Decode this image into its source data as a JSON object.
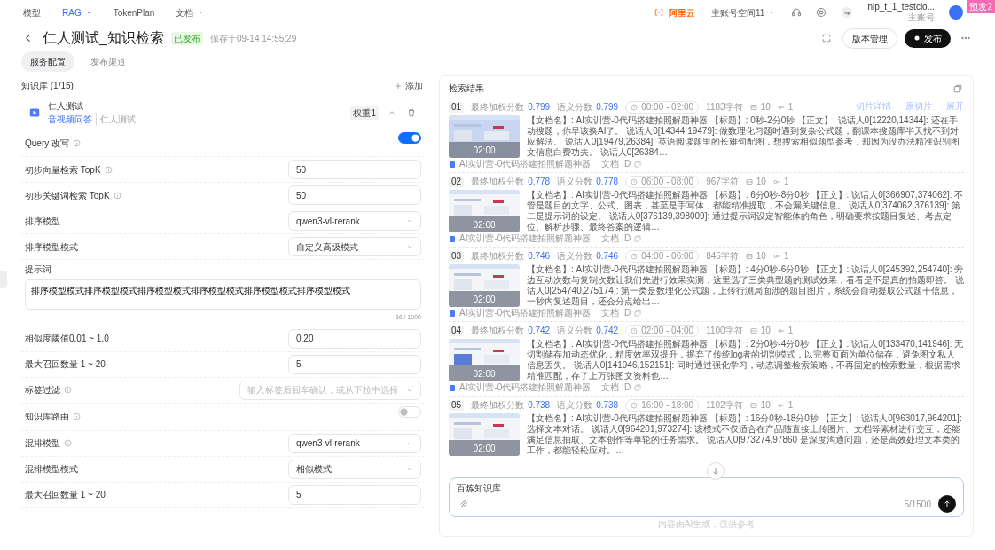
{
  "top_nav": {
    "items": [
      {
        "label": "模型",
        "selected": false,
        "dropdown": false
      },
      {
        "label": "RAG",
        "selected": true,
        "dropdown": true
      },
      {
        "label": "TokenPlan",
        "selected": false,
        "dropdown": false
      },
      {
        "label": "文档",
        "selected": false,
        "dropdown": true
      }
    ],
    "brand": "阿里云",
    "workspace": "主账号空间11",
    "user": {
      "name": "nlp_t_1_testclo...",
      "role": "主账号"
    },
    "env_badge": "预发2"
  },
  "page_header": {
    "title": "仁人测试_知识检索",
    "status": "已发布",
    "saved": "保存于09-14 14:55:29",
    "buttons": [
      {
        "label": "版本管理",
        "kind": "outline"
      },
      {
        "label": "发布",
        "kind": "primary"
      }
    ]
  },
  "tabs": [
    {
      "label": "服务配置",
      "selected": true
    },
    {
      "label": "发布渠道",
      "selected": false
    }
  ],
  "knowledge_base": {
    "title": "知识库 (1/15)",
    "add": "添加",
    "items": [
      {
        "name": "仁人测试",
        "type": "音视频问答",
        "label": "仁人测试",
        "weight": "权重1"
      }
    ]
  },
  "settings": [
    {
      "kind": "toggle",
      "label": "Query 改写",
      "info": true,
      "on": true
    },
    {
      "kind": "input",
      "label": "初步向量检索 TopK",
      "info": true,
      "value": "50"
    },
    {
      "kind": "input",
      "label": "初步关键词检索 TopK",
      "info": true,
      "value": "50"
    },
    {
      "kind": "select",
      "label": "排序模型",
      "info": false,
      "value": "qwen3-vl-rerank"
    },
    {
      "kind": "select",
      "label": "排序模型模式",
      "info": false,
      "value": "自定义高级模式"
    },
    {
      "kind": "textarea",
      "label": "提示词",
      "info": false,
      "value": "排序模型模式排序模型模式排序模型模式排序模型模式排序模型模式排序模型模式",
      "counter": "36 / 1000"
    },
    {
      "kind": "input",
      "label": "相似度阈值0.01 ~ 1.0",
      "info": false,
      "value": "0.20"
    },
    {
      "kind": "input",
      "label": "最大召回数量 1 ~ 20",
      "info": false,
      "value": "5"
    },
    {
      "kind": "select",
      "label": "标签过滤",
      "info": true,
      "placeholder": "输入标签后回车确认，或从下拉中选择"
    },
    {
      "kind": "toggle",
      "label": "知识库路由",
      "info": true,
      "on": false
    },
    {
      "kind": "select",
      "label": "混排模型",
      "info": true,
      "value": "qwen3-vl-rerank"
    },
    {
      "kind": "select",
      "label": "混排模型模式",
      "info": false,
      "value": "相似模式"
    },
    {
      "kind": "input",
      "label": "最大召回数量 1 ~ 20",
      "info": false,
      "value": "5"
    }
  ],
  "results": {
    "title": "检索结果",
    "hover_actions": [
      "切片详情",
      "原切片",
      "展开"
    ],
    "items": [
      {
        "rank": "01",
        "final_label": "最终加权分数",
        "final_score": "0.799",
        "semantic_label": "语义分数",
        "semantic_score": "0.799",
        "time": "00:00 - 02:00",
        "chars": "1183字符",
        "images": "10",
        "refs": "1",
        "duration": "02:00",
        "text": "【文档名】: AI实训营-0代码搭建拍照解题神器 【标题】: 0秒-2分0秒 【正文】: 说话人0[12220,14344]: 还在手动搜题，你早该换AI了。 说话人0[14344,19479]: 做数理化习题时遇到复杂公式题，翻课本搜题库半天找不到对应解法。 说话人0[19479,26384]: 英语阅读题里的长难句配图，想搜索相似题型参考，却因为没办法精准识别图文信息白费功夫。 说话人0[26384…",
        "doc": "AI实训营-0代码搭建拍照解题神器",
        "doc_id": "文档 ID"
      },
      {
        "rank": "02",
        "final_label": "最终加权分数",
        "final_score": "0.778",
        "semantic_label": "语义分数",
        "semantic_score": "0.778",
        "time": "06:00 - 08:00",
        "chars": "967字符",
        "images": "10",
        "refs": "1",
        "duration": "02:00",
        "text": "【文档名】: AI实训营-0代码搭建拍照解题神器 【标题】: 6分0秒-8分0秒 【正文】: 说话人0[366907,374062]: 不管是题目的文字、公式、图表，甚至是手写体，都能精准提取，不会漏关键信息。 说话人0[374062,376139]: 第二是提示词的设定。 说话人0[376139,398009]: 通过提示词设定智能体的角色，明确要求按题目复述、考点定位、解析步骤、最终答案的逻辑…",
        "doc": "AI实训营-0代码搭建拍照解题神器",
        "doc_id": "文档 ID"
      },
      {
        "rank": "03",
        "final_label": "最终加权分数",
        "final_score": "0.746",
        "semantic_label": "语义分数",
        "semantic_score": "0.746",
        "time": "04:00 - 06:00",
        "chars": "845字符",
        "images": "10",
        "refs": "1",
        "duration": "02:00",
        "text": "【文档名】: AI实训营-0代码搭建拍照解题神器 【标题】: 4分0秒-6分0秒 【正文】: 说话人0[245392,254740]: 旁边互动次数与复制次数让我们先进行效果实测，这里选了三类典型题的测试效果，看看是不是真的拍题即答。 说话人0[254740,275174]: 第一类是数理化公式题，上传行测局面涉的题目图片，系统会自动提取公式题干信息，一秒内复述题目，还会分点给出…",
        "doc": "AI实训营-0代码搭建拍照解题神器",
        "doc_id": "文档 ID"
      },
      {
        "rank": "04",
        "final_label": "最终加权分数",
        "final_score": "0.742",
        "semantic_label": "语义分数",
        "semantic_score": "0.742",
        "time": "02:00 - 04:00",
        "chars": "1100字符",
        "images": "10",
        "refs": "1",
        "duration": "02:00",
        "text": "【文档名】: AI实训营-0代码搭建拍照解题神器 【标题】: 2分0秒-4分0秒 【正文】: 说话人0[133470,141946]: 无切割储存加动态优化，精度效率双提升，摒弃了传统log者的切割模式，以完整页面为单位储存，避免图文私人信息丢失。 说话人0[141946,152151]: 同时通过强化学习，动态调整检索策略，不再固定的检索数量，根据需求精准匹配，存了上万张图文资料也…",
        "doc": "AI实训营-0代码搭建拍照解题神器",
        "doc_id": "文档 ID"
      },
      {
        "rank": "05",
        "final_label": "最终加权分数",
        "final_score": "0.738",
        "semantic_label": "语义分数",
        "semantic_score": "0.738",
        "time": "16:00 - 18:00",
        "chars": "1102字符",
        "images": "10",
        "refs": "1",
        "duration": "02:00",
        "text": "【文档名】: AI实训营-0代码搭建拍照解题神器 【标题】: 16分0秒-18分0秒 【正文】: 说话人0[963017,964201]: 选择文本对话。 说话人0[964201,973274]: 该模式不仅适合在产品随直接上传图片、文档等素材进行交互，还能满足信息抽取、文本创作等单轮的任务需求。 说话人0[973274,97860 是深度沟通问题，还是高效处理文本类的工作，都能轻松应对。…"
      }
    ]
  },
  "composer": {
    "value": "百炼知识库",
    "counter": "5/1500",
    "disclaimer": "内容由AI生成，仅供参考"
  }
}
